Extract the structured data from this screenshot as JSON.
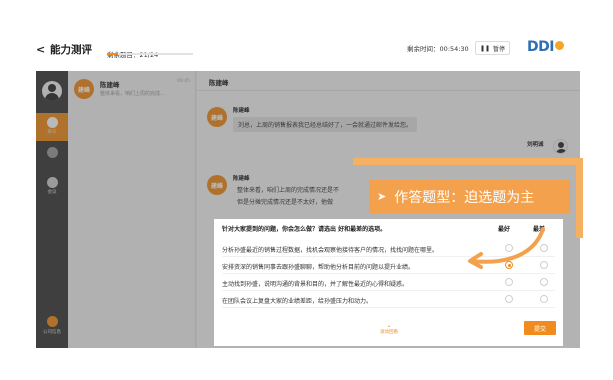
{
  "header": {
    "back_symbol": "<",
    "title": "能力测评",
    "remaining_questions": "剩余题目：21/24",
    "progress_fraction": 0.125,
    "remaining_time": "剩余时间：00:54:30",
    "pause_label": "暂停",
    "logo_text": "DDI",
    "accent_color": "#f08c1e"
  },
  "sidebar": {
    "items": [
      {
        "label": "聊天",
        "active": true
      },
      {
        "label": "",
        "active": false
      },
      {
        "label": "会议",
        "active": false
      }
    ],
    "company_label": "公司信息"
  },
  "contacts": [
    {
      "avatar_text": "建峰",
      "name": "陈建峰",
      "preview": "整体来看，咱们上周的完成...",
      "time": "09:45"
    }
  ],
  "chat": {
    "header_title": "陈建峰",
    "messages": [
      {
        "sender": "陈建峰",
        "avatar_text": "建峰",
        "text": "刘总，上周的销售报表我已经总结好了，一会就通过邮件发给您。"
      },
      {
        "sender": "刘明诚",
        "avatar_text": "",
        "text": ""
      },
      {
        "sender": "陈建峰",
        "avatar_text": "建峰",
        "lines": [
          "整体来看，咱们上周的完成情况还是不",
          "但是分摊完成情况还是不太好，他做"
        ]
      }
    ],
    "obscured_line": "咱们确定，我们的汇报看看，整体和我们的不同的方便"
  },
  "question": {
    "prompt": "针对大家提到的问题，你会怎么做？请选出       好和最差的选项。",
    "best_label": "最好",
    "worst_label": "最差",
    "options": [
      {
        "text": "分析孙盛最近的销售过程数据，找机会观察他接待客户的情况，找找问题在哪里。",
        "best": false,
        "worst": false
      },
      {
        "text": "安排资深的销售同事去跟孙盛聊聊，帮助他分析目前的问题以提升业绩。",
        "best": true,
        "worst": false
      },
      {
        "text": "主动找到孙盛，说明沟通的背景和目的，并了解性最近的心得和疑惑。",
        "best": false,
        "worst": false
      },
      {
        "text": "在团队会议上复盘大家的业绩差距，给孙盛压力和动力。",
        "best": false,
        "worst": false
      }
    ],
    "view_history_label": "滚动回看",
    "submit_label": "提交"
  },
  "annotation": {
    "arrow_symbol": "➤",
    "text": "作答题型：迫选题为主",
    "color": "#f3a14c"
  }
}
